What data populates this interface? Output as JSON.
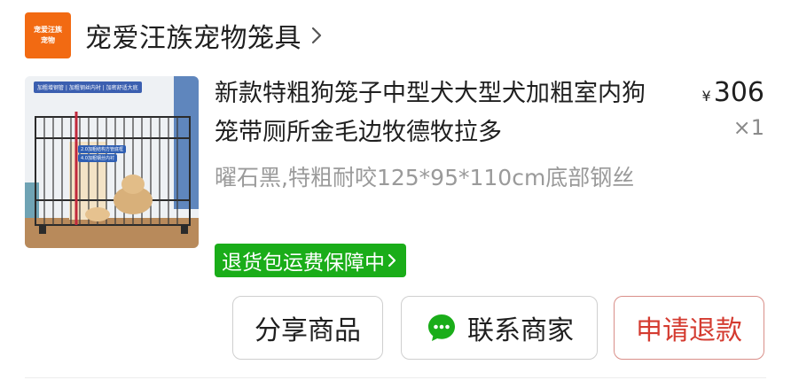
{
  "shop": {
    "logo_line1": "宠爱汪族",
    "logo_line2": "宠物",
    "name": "宠爱汪族宠物笼具"
  },
  "product": {
    "image_banner": "加粗增钢管 | 加粗钢丝内衬 | 加密舒适大底",
    "image_label1": "2.0加粗结构方管底框",
    "image_label2": "4.0加粗钢丝内衬",
    "title": "新款特粗狗笼子中型犬大型犬加粗室内狗笼带厕所金毛边牧德牧拉多",
    "currency": "¥",
    "price": "306",
    "quantity": "×1",
    "spec": "曜石黑,特粗耐咬125*95*110cm底部钢丝",
    "badge": "退货包运费保障中"
  },
  "actions": {
    "share": "分享商品",
    "contact": "联系商家",
    "refund": "申请退款"
  },
  "colors": {
    "logo": "#f26a12",
    "badge_green": "#1aad19",
    "refund_red": "#d43b30",
    "chat_green": "#1aad19"
  },
  "icons": [
    "chevron-right-icon",
    "chat-bubble-icon"
  ]
}
